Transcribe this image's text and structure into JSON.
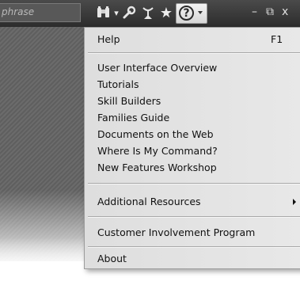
{
  "toolbar": {
    "search_placeholder": "phrase",
    "icons": [
      "binoculars-icon",
      "wrench-icon",
      "satellite-dish-icon",
      "star-icon",
      "help-icon"
    ],
    "window_controls": {
      "minimize": "–",
      "restore": "⧉",
      "close": "x"
    }
  },
  "help_menu": {
    "sections": [
      [
        {
          "label": "Help",
          "shortcut": "F1"
        }
      ],
      [
        {
          "label": "User Interface Overview"
        },
        {
          "label": "Tutorials"
        },
        {
          "label": "Skill Builders"
        },
        {
          "label": "Families Guide"
        },
        {
          "label": "Documents on the Web"
        },
        {
          "label": "Where Is My Command?"
        },
        {
          "label": "New Features Workshop"
        }
      ],
      [
        {
          "label": "Additional Resources",
          "has_submenu": true
        }
      ],
      [
        {
          "label": "Customer Involvement Program"
        }
      ],
      [
        {
          "label": "About"
        }
      ]
    ]
  },
  "colors": {
    "toolbar_bg": "#333333",
    "menu_bg": "#e4e4e4",
    "menu_text": "#111111",
    "separator": "#a8a8a8"
  }
}
